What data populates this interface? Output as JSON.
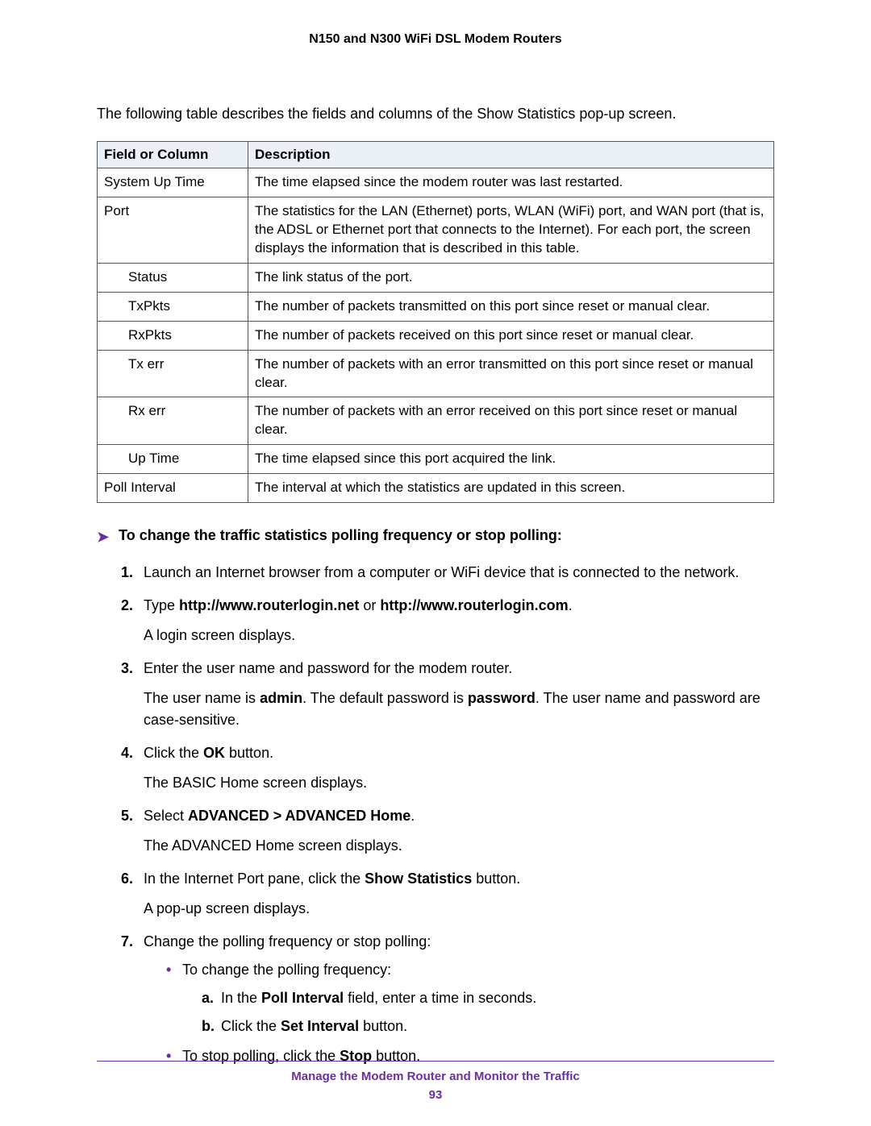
{
  "header": {
    "title": "N150 and N300 WiFi DSL Modem Routers"
  },
  "intro": "The following table describes the fields and columns of the Show Statistics pop-up screen.",
  "table": {
    "headers": [
      "Field or Column",
      "Description"
    ],
    "rows": [
      {
        "field": "System Up Time",
        "desc": "The time elapsed since the modem router was last restarted.",
        "indent": false
      },
      {
        "field": "Port",
        "desc": "The statistics for the LAN (Ethernet) ports, WLAN (WiFi) port, and WAN port (that is, the ADSL or Ethernet port that connects to the Internet). For each port, the screen displays the information that is described in this table.",
        "indent": false
      },
      {
        "field": "Status",
        "desc": "The link status of the port.",
        "indent": true
      },
      {
        "field": "TxPkts",
        "desc": "The number of packets transmitted on this port since reset or manual clear.",
        "indent": true
      },
      {
        "field": "RxPkts",
        "desc": "The number of packets received on this port since reset or manual clear.",
        "indent": true
      },
      {
        "field": "Tx err",
        "desc": "The number of packets with an error transmitted on this port since reset or manual clear.",
        "indent": true
      },
      {
        "field": "Rx err",
        "desc": "The number of packets with an error received on this port since reset or manual clear.",
        "indent": true
      },
      {
        "field": "Up Time",
        "desc": "The time elapsed since this port acquired the link.",
        "indent": true
      },
      {
        "field": "Poll Interval",
        "desc": "The interval at which the statistics are updated in this screen.",
        "indent": false
      }
    ]
  },
  "proc_heading": "To change the traffic statistics polling frequency or stop polling:",
  "steps": {
    "s1": {
      "num": "1.",
      "text": "Launch an Internet browser from a computer or WiFi device that is connected to the network."
    },
    "s2": {
      "num": "2.",
      "pre": "Type ",
      "url1": "http://www.routerlogin.net",
      "or": " or ",
      "url2": "http://www.routerlogin.com",
      "post": ".",
      "sub": "A login screen displays."
    },
    "s3": {
      "num": "3.",
      "text": "Enter the user name and password for the modem router.",
      "sub_pre": "The user name is ",
      "admin": "admin",
      "mid": ". The default password is ",
      "password": "password",
      "sub_post": ". The user name and password are case-sensitive."
    },
    "s4": {
      "num": "4.",
      "pre": "Click the ",
      "ok": "OK",
      "post": " button.",
      "sub": "The BASIC Home screen displays."
    },
    "s5": {
      "num": "5.",
      "pre": "Select ",
      "path": "ADVANCED > ADVANCED Home",
      "post": ".",
      "sub": "The ADVANCED Home screen displays."
    },
    "s6": {
      "num": "6.",
      "pre": "In the Internet Port pane, click the ",
      "btn": "Show Statistics",
      "post": " button.",
      "sub": "A pop-up screen displays."
    },
    "s7": {
      "num": "7.",
      "text": "Change the polling frequency or stop polling:",
      "bullet1": "To change the polling frequency:",
      "a": {
        "letter": "a.",
        "pre": "In the ",
        "field": "Poll Interval",
        "post": " field, enter a time in seconds."
      },
      "b": {
        "letter": "b.",
        "pre": "Click the ",
        "btn": "Set Interval",
        "post": " button."
      },
      "bullet2_pre": "To stop polling, click the ",
      "bullet2_btn": "Stop",
      "bullet2_post": " button."
    }
  },
  "footer": {
    "title": "Manage the Modem Router and Monitor the Traffic",
    "page": "93"
  }
}
